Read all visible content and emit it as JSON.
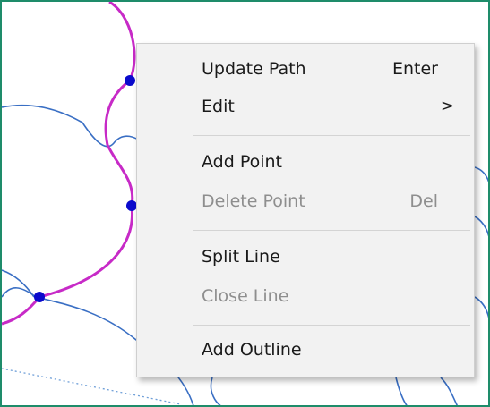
{
  "context_menu": {
    "items": [
      {
        "label": "Update Path",
        "shortcut": "Enter",
        "enabled": true
      },
      {
        "label": "Edit",
        "submenu_arrow": ">",
        "enabled": true
      },
      {
        "label": "Add Point",
        "enabled": true
      },
      {
        "label": "Delete Point",
        "shortcut": "Del",
        "enabled": false
      },
      {
        "label": "Split Line",
        "enabled": true
      },
      {
        "label": "Close Line",
        "enabled": false
      },
      {
        "label": "Add Outline",
        "enabled": true
      }
    ]
  },
  "colors": {
    "frame_border": "#1e8c6a",
    "selected_path": "#c72ac7",
    "unselected_path": "#3a6fc4",
    "point": "#0a0acc",
    "menu_background": "#f2f2f2",
    "disabled_text": "#8e8e8e"
  }
}
